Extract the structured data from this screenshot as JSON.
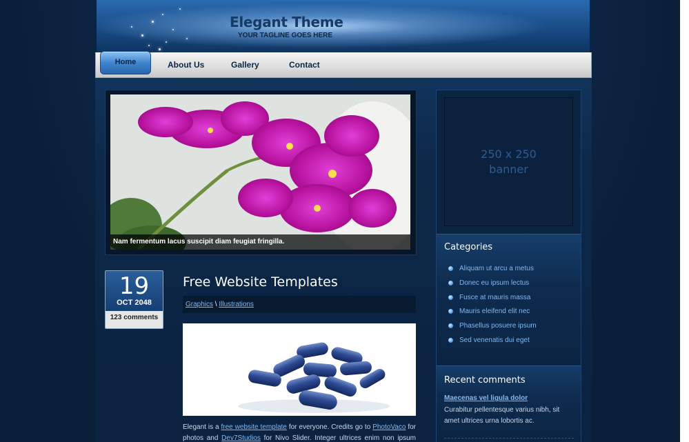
{
  "header": {
    "title": "Elegant Theme",
    "tagline": "YOUR TAGLINE GOES HERE"
  },
  "nav": {
    "items": [
      {
        "label": "Home",
        "active": true
      },
      {
        "label": "About Us"
      },
      {
        "label": "Gallery"
      },
      {
        "label": "Contact"
      }
    ]
  },
  "slider": {
    "caption": "Nam fermentum lacus suscipit diam feugiat fringilla."
  },
  "post": {
    "date_day": "19",
    "date_month": "OCT 2048",
    "comments": "123 comments",
    "title": "Free Website Templates",
    "categories": [
      "Graphics",
      "Illustrations"
    ],
    "category_separator": "\\",
    "text_part1": "Elegant is a",
    "link1": "free website template",
    "text_part2": "for everyone. Credits go to",
    "link2": "PhotoVaco",
    "text_part3": "for photos and",
    "link3": "Dev7Studios",
    "text_part4": "for Nivo Slider. Integer ultrices enim non ipsum pulvinar,"
  },
  "sidebar": {
    "banner_line1": "250 x 250",
    "banner_line2": "banner",
    "categories_heading": "Categories",
    "categories": [
      "Aliquam ut arcu a metus",
      "Donec eu ipsum lectus",
      "Fusce at mauris massa",
      "Mauris eleifend elit nec",
      "Phasellus posuere ipsum",
      "Sed venenatis dui eget"
    ],
    "comments_heading": "Recent comments",
    "comment_title": "Maecenas vel ligula dolor",
    "comment_text": "Curabitur pellentesque varius nibh, sit amet ultrices urna lobortis ac."
  },
  "colors": {
    "background": "#0a1e38",
    "link": "#7fb9f3",
    "nav_active": "#3f86cf"
  }
}
